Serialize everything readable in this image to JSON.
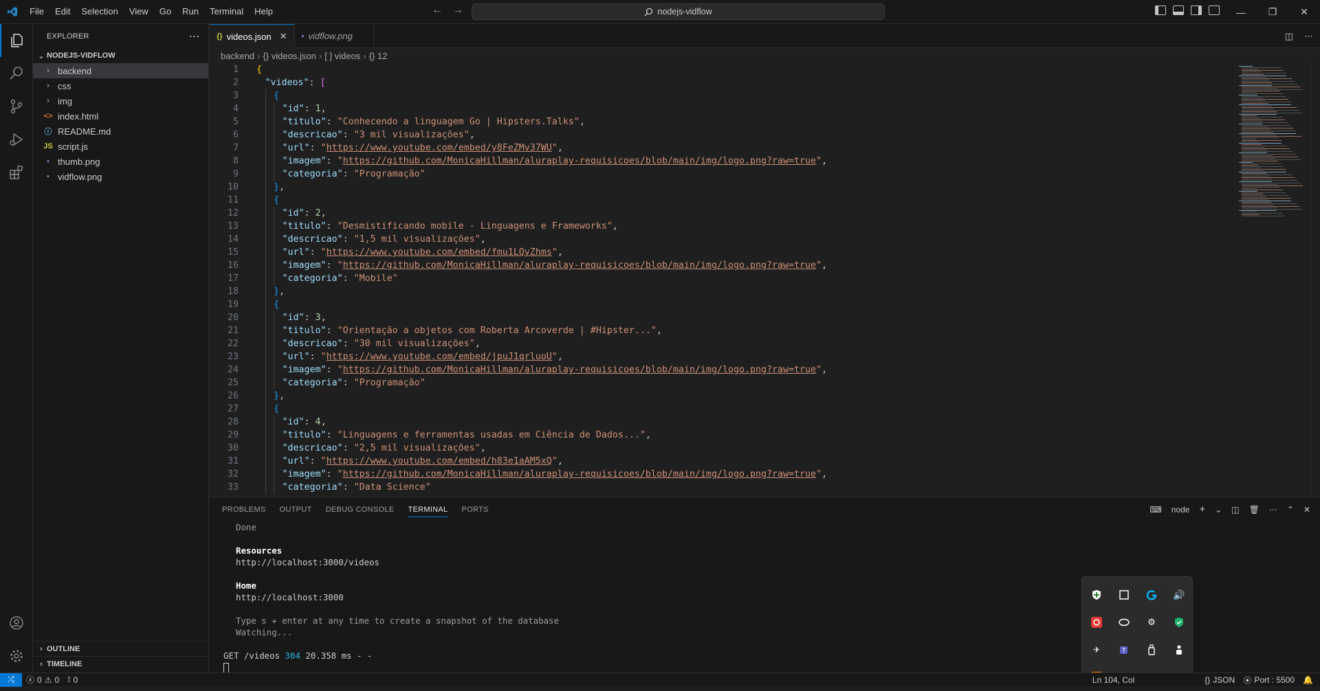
{
  "titlebar": {
    "menus": [
      "File",
      "Edit",
      "Selection",
      "View",
      "Go",
      "Run",
      "Terminal",
      "Help"
    ],
    "search_text": "nodejs-vidflow"
  },
  "explorer": {
    "header": "EXPLORER",
    "project": "NODEJS-VIDFLOW",
    "items": [
      {
        "label": "backend",
        "type": "folder",
        "icon": "chevron-right-icon"
      },
      {
        "label": "css",
        "type": "folder",
        "icon": "chevron-right-icon"
      },
      {
        "label": "img",
        "type": "folder",
        "icon": "chevron-right-icon"
      },
      {
        "label": "index.html",
        "type": "file",
        "icon": "html-file-icon",
        "icon_text": "<>",
        "color": "#e37933"
      },
      {
        "label": "README.md",
        "type": "file",
        "icon": "info-icon",
        "icon_text": "ⓘ",
        "color": "#519aba"
      },
      {
        "label": "script.js",
        "type": "file",
        "icon": "js-file-icon",
        "icon_text": "JS",
        "color": "#cbcb41"
      },
      {
        "label": "thumb.png",
        "type": "file",
        "icon": "image-file-icon",
        "icon_text": "▪",
        "color": "#a074c4"
      },
      {
        "label": "vidflow.png",
        "type": "file",
        "icon": "image-file-icon",
        "icon_text": "▪",
        "color": "#a074c4"
      }
    ],
    "outline": "OUTLINE",
    "timeline": "TIMELINE"
  },
  "tabs": [
    {
      "label": "videos.json",
      "icon_text": "{}",
      "active": true
    },
    {
      "label": "vidflow.png",
      "icon_text": "▪",
      "active": false
    }
  ],
  "breadcrumb": [
    "backend",
    "{} videos.json",
    "[ ] videos",
    "{} 12"
  ],
  "editor": {
    "lines": [
      "1",
      "2",
      "3",
      "4",
      "5",
      "6",
      "7",
      "8",
      "9",
      "10",
      "11",
      "12",
      "13",
      "14",
      "15",
      "16",
      "17",
      "18",
      "19",
      "20",
      "21",
      "22",
      "23",
      "24",
      "25",
      "26",
      "27",
      "28",
      "29",
      "30",
      "31",
      "32",
      "33"
    ],
    "videos": [
      {
        "id": "1",
        "titulo": "\"Conhecendo a linguagem Go | Hipsters.Talks\"",
        "descricao": "\"3 mil visualizações\"",
        "url": "https://www.youtube.com/embed/y8FeZMv37WU",
        "imagem": "https://github.com/MonicaHillman/aluraplay-requisicoes/blob/main/img/logo.png?raw=true",
        "categoria": "\"Programação\""
      },
      {
        "id": "2",
        "titulo": "\"Desmistificando mobile - Linguagens e Frameworks\"",
        "descricao": "\"1,5 mil visualizações\"",
        "url": "https://www.youtube.com/embed/fmu1LQvZhms",
        "imagem": "https://github.com/MonicaHillman/aluraplay-requisicoes/blob/main/img/logo.png?raw=true",
        "categoria": "\"Mobile\""
      },
      {
        "id": "3",
        "titulo": "\"Orientação a objetos com Roberta Arcoverde | #Hipster...\"",
        "descricao": "\"30 mil visualizações\"",
        "url": "https://www.youtube.com/embed/jpuJ1qrluoU",
        "imagem": "https://github.com/MonicaHillman/aluraplay-requisicoes/blob/main/img/logo.png?raw=true",
        "categoria": "\"Programação\""
      },
      {
        "id": "4",
        "titulo": "\"Linguagens e ferramentas usadas em Ciência de Dados...\"",
        "descricao": "\"2,5 mil visualizações\"",
        "url": "https://www.youtube.com/embed/h83e1aAM5xQ",
        "imagem": "https://github.com/MonicaHillman/aluraplay-requisicoes/blob/main/img/logo.png?raw=true",
        "categoria": "\"Data Science\""
      }
    ]
  },
  "panel": {
    "tabs": [
      "PROBLEMS",
      "OUTPUT",
      "DEBUG CONSOLE",
      "TERMINAL",
      "PORTS"
    ],
    "active_tab": "TERMINAL",
    "terminal_name": "node",
    "terminal": {
      "done": "Done",
      "resources_label": "Resources",
      "resources_url": "http://localhost:3000/videos",
      "home_label": "Home",
      "home_url": "http://localhost:3000",
      "hint": "Type s + enter at any time to create a snapshot of the database",
      "watching": "Watching...",
      "req_prefix": "GET /videos ",
      "req_status": "304",
      "req_suffix": " 20.358 ms - -"
    }
  },
  "statusbar": {
    "errors": "0",
    "warnings": "0",
    "ports": "0",
    "position": "Ln 104, Col",
    "language": "JSON",
    "port": "Port : 5500"
  },
  "colors": {
    "accent": "#0078d4",
    "string": "#ce9178",
    "key": "#9cdcfe",
    "number": "#b5cea8"
  }
}
